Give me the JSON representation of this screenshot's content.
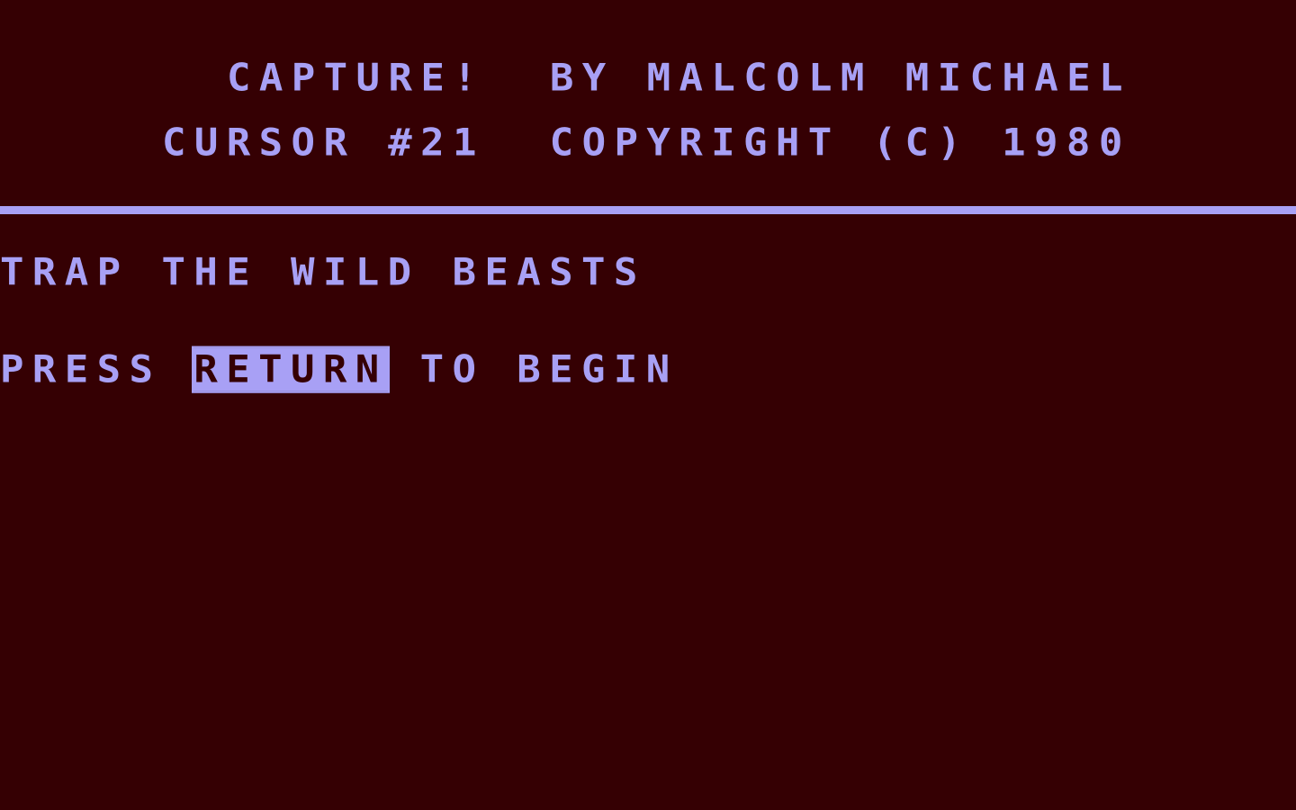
{
  "screen": {
    "title_line": "CAPTURE!  BY MALCOLM MICHAEL",
    "credit_line": "CURSOR #21  COPYRIGHT (C) 1980",
    "tagline": "TRAP THE WILD BEASTS",
    "prompt_prefix": "PRESS ",
    "prompt_key": "RETURN",
    "prompt_suffix": " TO BEGIN"
  },
  "colors": {
    "background": "#350003",
    "foreground": "#a8a0f5"
  }
}
